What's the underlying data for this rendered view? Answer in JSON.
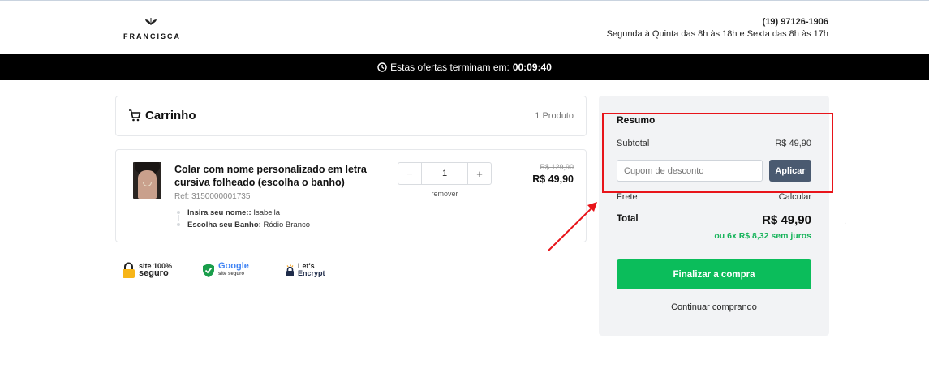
{
  "header": {
    "brand": "FRANCISCA",
    "phone": "(19) 97126-1906",
    "hours": "Segunda à Quinta das 8h às 18h e Sexta das 8h às 17h"
  },
  "timer": {
    "text": "Estas ofertas terminam em:",
    "time": "00:09:40"
  },
  "cart": {
    "title": "Carrinho",
    "count": "1 Produto",
    "item": {
      "name": "Colar com nome personalizado em letra cursiva folheado (escolha o banho)",
      "ref": "Ref: 3150000001735",
      "options": [
        {
          "label": "Insira seu nome::",
          "value": "Isabella"
        },
        {
          "label": "Escolha seu Banho:",
          "value": "Ródio Branco"
        }
      ],
      "qty": "1",
      "qty_minus": "−",
      "qty_plus": "+",
      "remove": "remover",
      "old_price": "R$ 129,90",
      "price": "R$ 49,90"
    }
  },
  "seals": {
    "site_top": "site 100%",
    "site_bottom": "seguro",
    "google_top": "Google",
    "google_bottom": "site seguro",
    "encrypt_top": "Let's",
    "encrypt_bottom": "Encrypt"
  },
  "summary": {
    "title": "Resumo",
    "subtotal_label": "Subtotal",
    "subtotal_value": "R$ 49,90",
    "coupon_placeholder": "Cupom de desconto",
    "apply": "Aplicar",
    "frete_label": "Frete",
    "frete_value": "Calcular",
    "total_label": "Total",
    "total_value": "R$ 49,90",
    "installments": "ou 6x R$ 8,32 sem juros",
    "checkout": "Finalizar a compra",
    "continue": "Continuar comprando"
  },
  "colors": {
    "accent_green": "#0bbd5b",
    "apply_button": "#4a5a70",
    "annotation_red": "#e8141a"
  },
  "stray_mark": "."
}
